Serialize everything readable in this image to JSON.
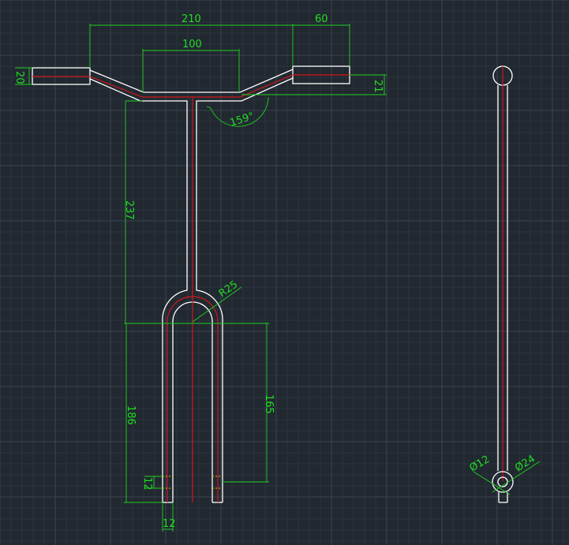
{
  "dimensions": {
    "overall_width": "210",
    "grip_length": "60",
    "center_width": "100",
    "grip_diameter": "20",
    "bar_drop": "21",
    "bend_angle": "159°",
    "stem_height": "237",
    "fork_radius": "R25",
    "fork_length": "186",
    "fork_slot": "165",
    "dropout_height": "12",
    "dropout_width": "12",
    "hole_inner_diameter": "Ø12",
    "hole_outer_diameter": "Ø24"
  },
  "colors": {
    "background": "#212830",
    "object_line": "#ffffff",
    "center_line": "#d01818",
    "dimension": "#22dd22",
    "hidden_line": "#d8c31c"
  }
}
